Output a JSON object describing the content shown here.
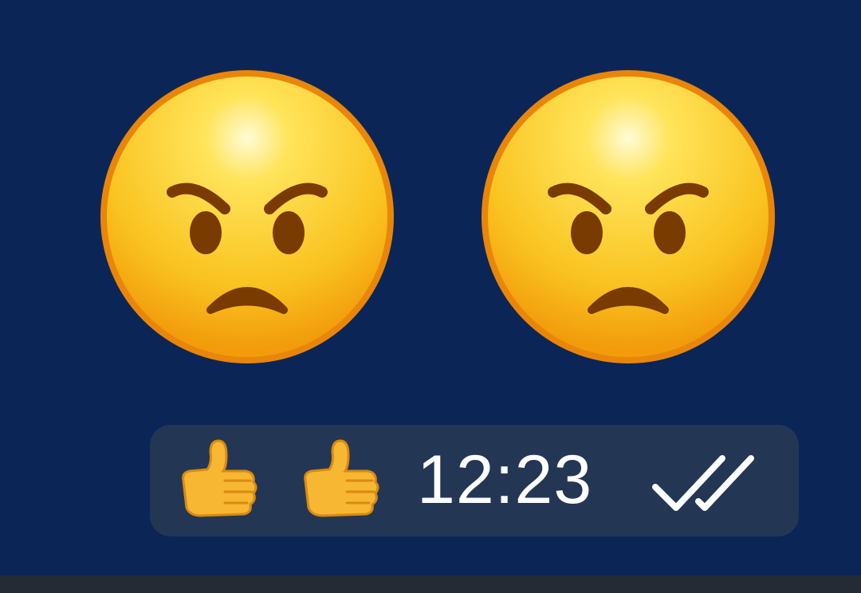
{
  "chat": {
    "background_color": "#0b2656",
    "message": {
      "emojis": [
        {
          "icon": "angry-face-icon",
          "glyph": "😠"
        },
        {
          "icon": "angry-face-icon",
          "glyph": "😠"
        }
      ],
      "reactions": [
        {
          "icon": "thumbs-up-icon",
          "glyph": "👍"
        },
        {
          "icon": "thumbs-up-icon",
          "glyph": "👍"
        }
      ],
      "time": "12:23",
      "status_icon": "double-check-icon",
      "bubble_color": "#233755"
    }
  },
  "bottom_bar_color": "#252b34"
}
